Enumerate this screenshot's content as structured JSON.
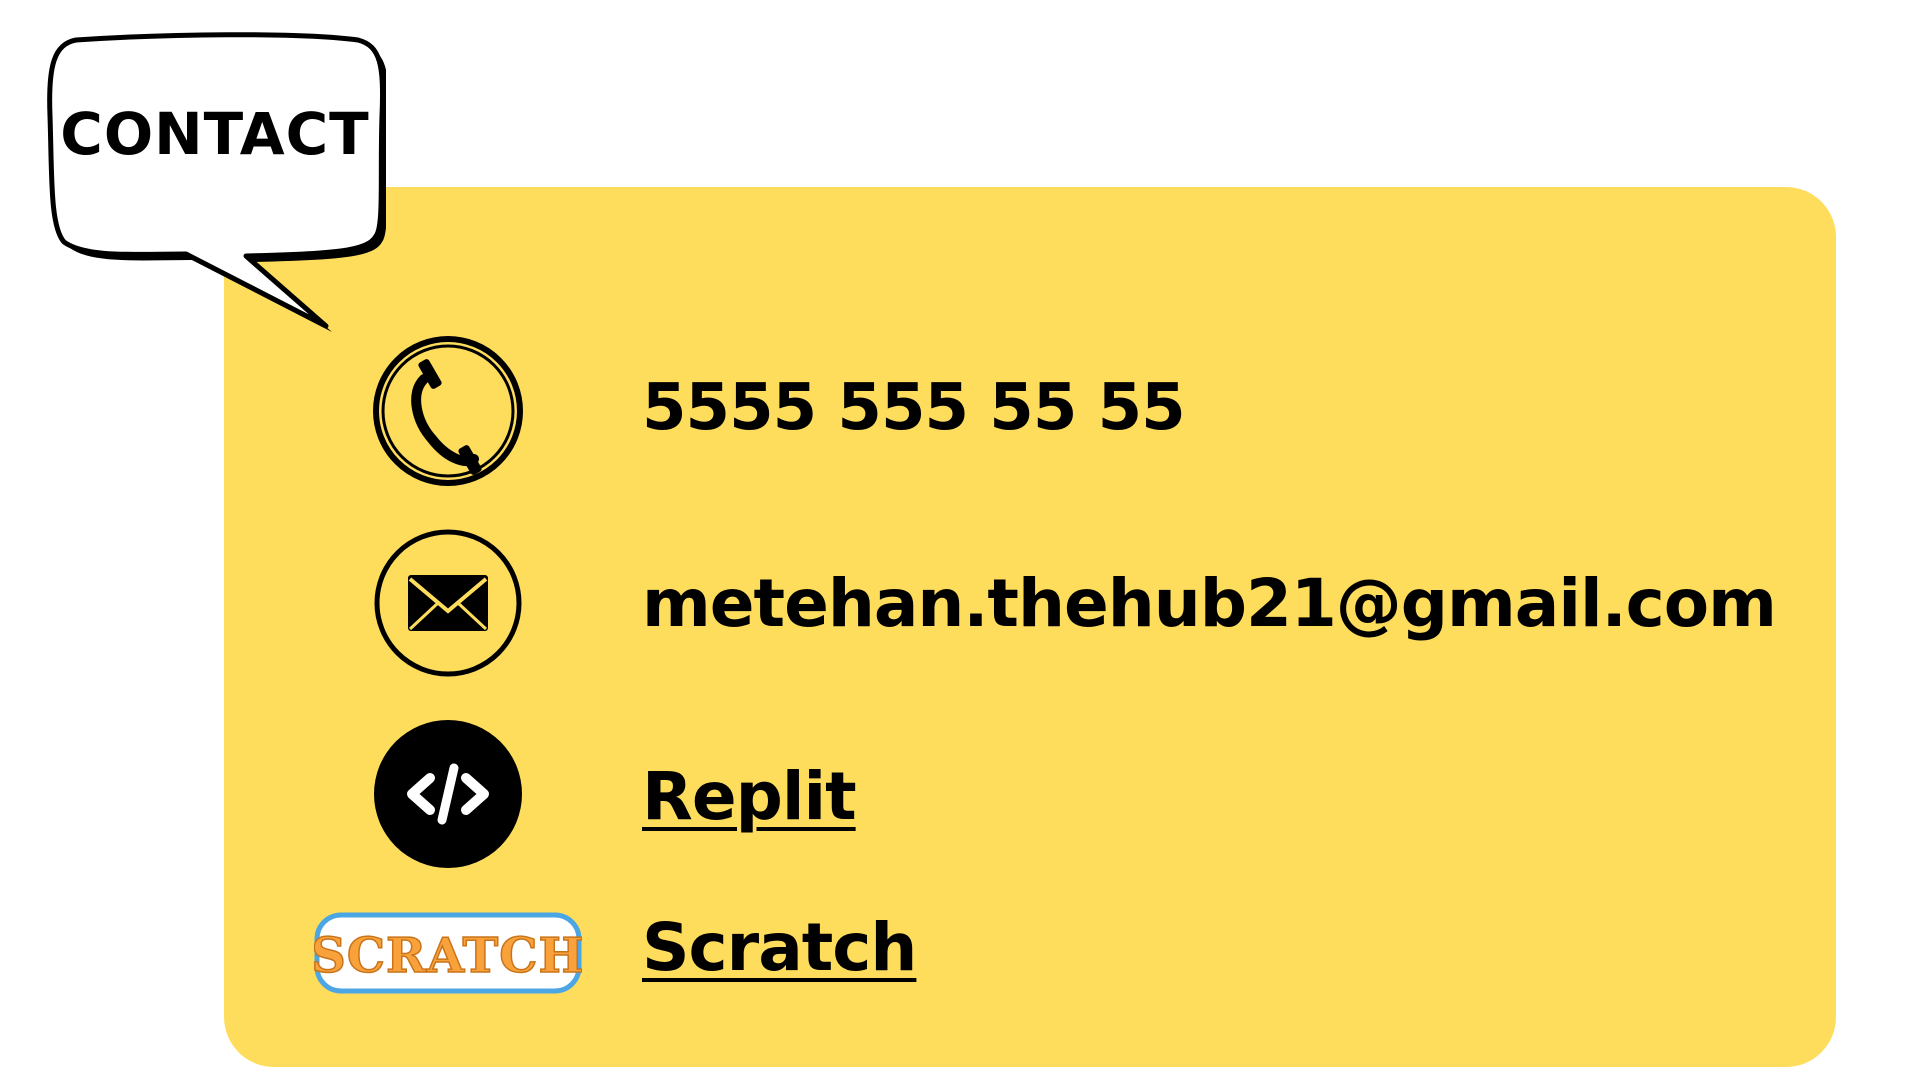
{
  "header": {
    "title": "CONTACT"
  },
  "contact": {
    "phone": "5555 555 55 55",
    "email": "metehan.thehub21@gmail.com",
    "links": [
      {
        "label": "Replit",
        "icon": "code-icon"
      },
      {
        "label": "Scratch",
        "icon": "scratch-logo"
      }
    ]
  },
  "logo": {
    "scratch_wordmark": "SCRATCH"
  },
  "colors": {
    "card": "#FEDD5C",
    "text": "#000000",
    "scratch_orange": "#F9A23B",
    "scratch_blue": "#4CA6E4"
  }
}
